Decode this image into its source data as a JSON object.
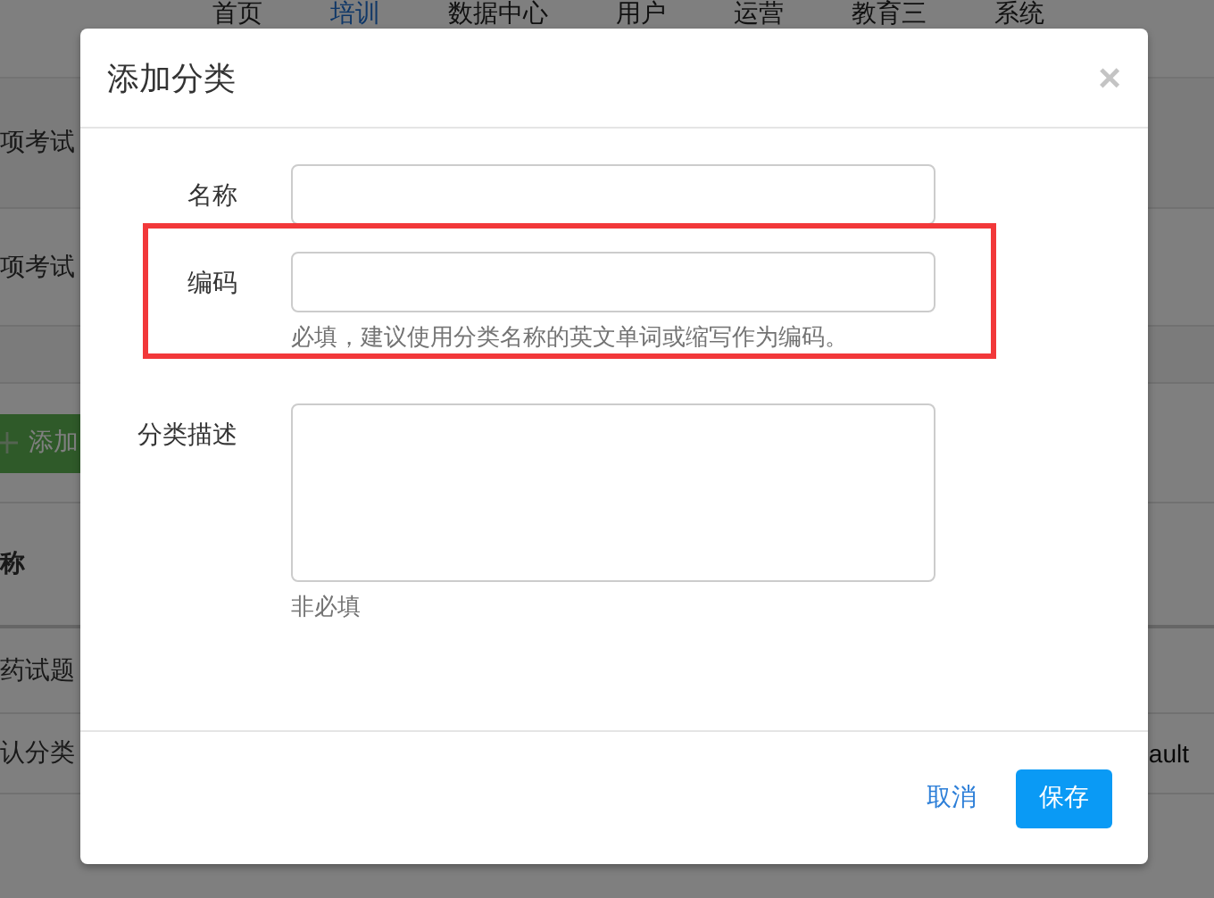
{
  "nav": [
    {
      "label": "首页",
      "selected": false
    },
    {
      "label": "培训",
      "selected": true
    },
    {
      "label": "数据中心",
      "selected": false
    },
    {
      "label": "用户",
      "selected": false
    },
    {
      "label": "运营",
      "selected": false
    },
    {
      "label": "教育三",
      "selected": false
    },
    {
      "label": "系统",
      "selected": false
    }
  ],
  "background_rows": [
    {
      "kind": "text",
      "text": "项考试"
    },
    {
      "kind": "text",
      "text": "项考试"
    },
    {
      "kind": "blank"
    },
    {
      "kind": "button",
      "text": "添加"
    },
    {
      "kind": "heading",
      "text": "称"
    },
    {
      "kind": "text",
      "text": "药试题"
    },
    {
      "kind": "text",
      "text": "认分类",
      "column_2": "ault"
    }
  ],
  "dialog": {
    "title": "添加分类",
    "close": "×",
    "fields": [
      {
        "kind": "input",
        "label": "名称",
        "highlighted": false
      },
      {
        "kind": "input",
        "label": "编码",
        "hint": "必填，建议使用分类名称的英文单词或缩写作为编码。",
        "highlighted": true
      },
      {
        "kind": "textarea",
        "label": "分类描述",
        "hint": "非必填",
        "highlighted": false
      }
    ],
    "buttons": [
      {
        "kind": "link",
        "label": "取消"
      },
      {
        "kind": "primary",
        "label": "保存"
      }
    ]
  }
}
